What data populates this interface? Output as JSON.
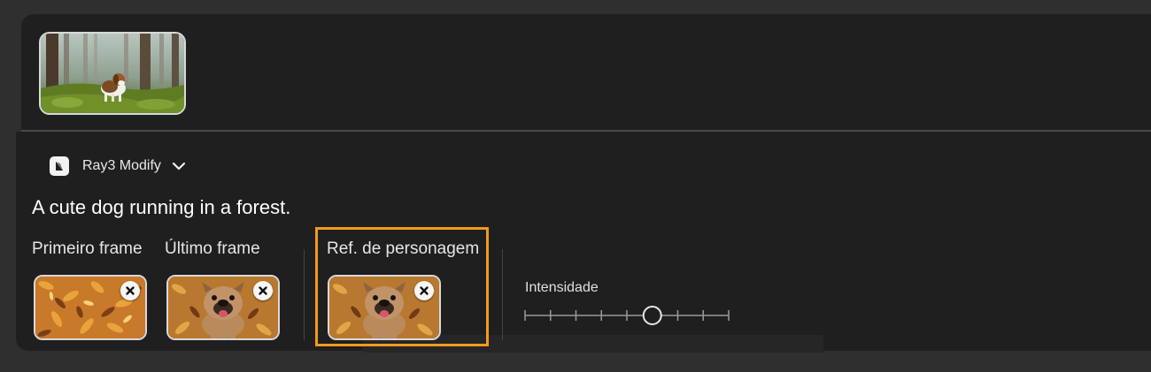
{
  "source": {
    "thumbnail_alt": "Beagle running in a forest"
  },
  "model": {
    "icon": "luma-logo-icon",
    "name": "Ray3 Modify",
    "dropdown_icon": "chevron-down-icon"
  },
  "prompt": {
    "text": "A cute dog running in a forest."
  },
  "frames": {
    "first": {
      "label": "Primeiro frame",
      "thumb": "autumn-leaves"
    },
    "last": {
      "label": "Último frame",
      "thumb": "bulldog-leaves"
    }
  },
  "character_ref": {
    "label": "Ref. de personagem",
    "thumb": "bulldog-leaves",
    "highlight_color": "#f29a1c"
  },
  "intensity": {
    "label": "Intensidade",
    "level_fraction": 0.625,
    "steps": 9
  },
  "colors": {
    "panel": "#1f1f1f",
    "background": "#2f2f2f",
    "accent": "#f29a1c"
  }
}
